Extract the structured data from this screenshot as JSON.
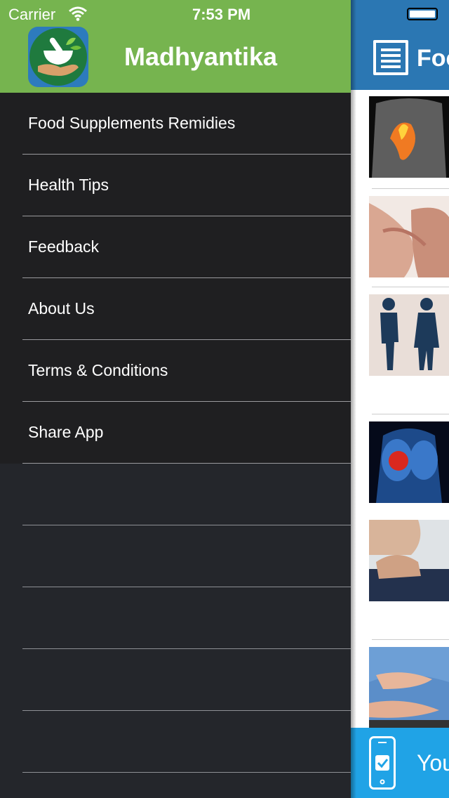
{
  "status_bar": {
    "carrier": "Carrier",
    "time": "7:53 PM"
  },
  "drawer": {
    "app_title": "Madhyantika",
    "logo_icon": "mortar-pestle-hand-icon",
    "menu": [
      {
        "label": "Food Supplements Remidies"
      },
      {
        "label": "Health Tips"
      },
      {
        "label": "Feedback"
      },
      {
        "label": "About Us"
      },
      {
        "label": "Terms & Conditions"
      },
      {
        "label": "Share App"
      }
    ]
  },
  "content": {
    "nav_title": "Foc",
    "nav_icon": "list-icon",
    "banner_text": "You",
    "banner_icon": "phone-check-icon",
    "colors": {
      "drawer_header": "#76b44f",
      "menu_bg": "#1f1f21",
      "nav_bar": "#2b77b3",
      "banner": "#20a3e6"
    }
  }
}
